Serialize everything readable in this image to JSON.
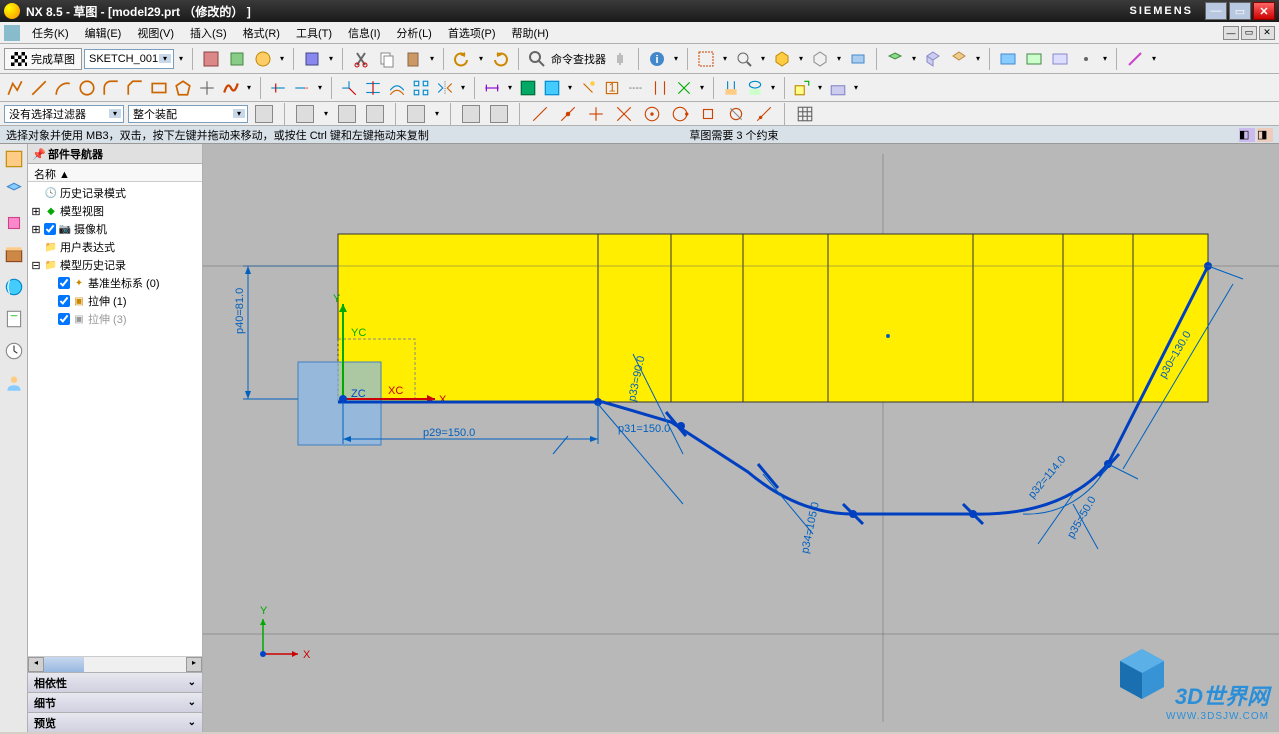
{
  "titlebar": {
    "title": "NX 8.5 - 草图 - [model29.prt （修改的） ]",
    "brand": "SIEMENS"
  },
  "menubar": {
    "task": "任务(K)",
    "edit": "编辑(E)",
    "view": "视图(V)",
    "insert": "插入(S)",
    "format": "格式(R)",
    "tools": "工具(T)",
    "info": "信息(I)",
    "analysis": "分析(L)",
    "preferences": "首选项(P)",
    "help": "帮助(H)"
  },
  "toolbar": {
    "finish_sketch": "完成草图",
    "sketch_name": "SKETCH_001",
    "cmd_finder": "命令查找器"
  },
  "filterbar": {
    "no_filter": "没有选择过滤器",
    "assembly": "整个装配"
  },
  "status": {
    "hint": "选择对象并使用 MB3，双击，按下左键并拖动来移动，或按住 Ctrl 键和左键拖动来复制",
    "constraint": "草图需要 3 个约束"
  },
  "navigator": {
    "title": "部件导航器",
    "col_name": "名称  ▲",
    "items": {
      "history_mode": "历史记录模式",
      "model_views": "模型视图",
      "cameras": "摄像机",
      "user_expr": "用户表达式",
      "model_history": "模型历史记录",
      "datum_csys": "基准坐标系 (0)",
      "extrude1": "拉伸 (1)",
      "extrude3": "拉伸 (3)"
    },
    "sections": {
      "dependency": "相依性",
      "details": "细节",
      "preview": "预览"
    }
  },
  "sketch": {
    "dims": {
      "p40": "p40=81.0",
      "p29": "p29=150.0",
      "p31": "p31=150.0",
      "p33": "p33=90.0",
      "p34": "p34=105.0",
      "p32": "p32=114.0",
      "p35": "p35=50.0",
      "p30": "p30=130.0"
    },
    "axes": {
      "x": "X",
      "y": "Y",
      "xc": "XC",
      "yc": "YC",
      "zc": "ZC"
    }
  },
  "watermark": {
    "text": "3D世界网",
    "url": "WWW.3DSJW.COM"
  }
}
